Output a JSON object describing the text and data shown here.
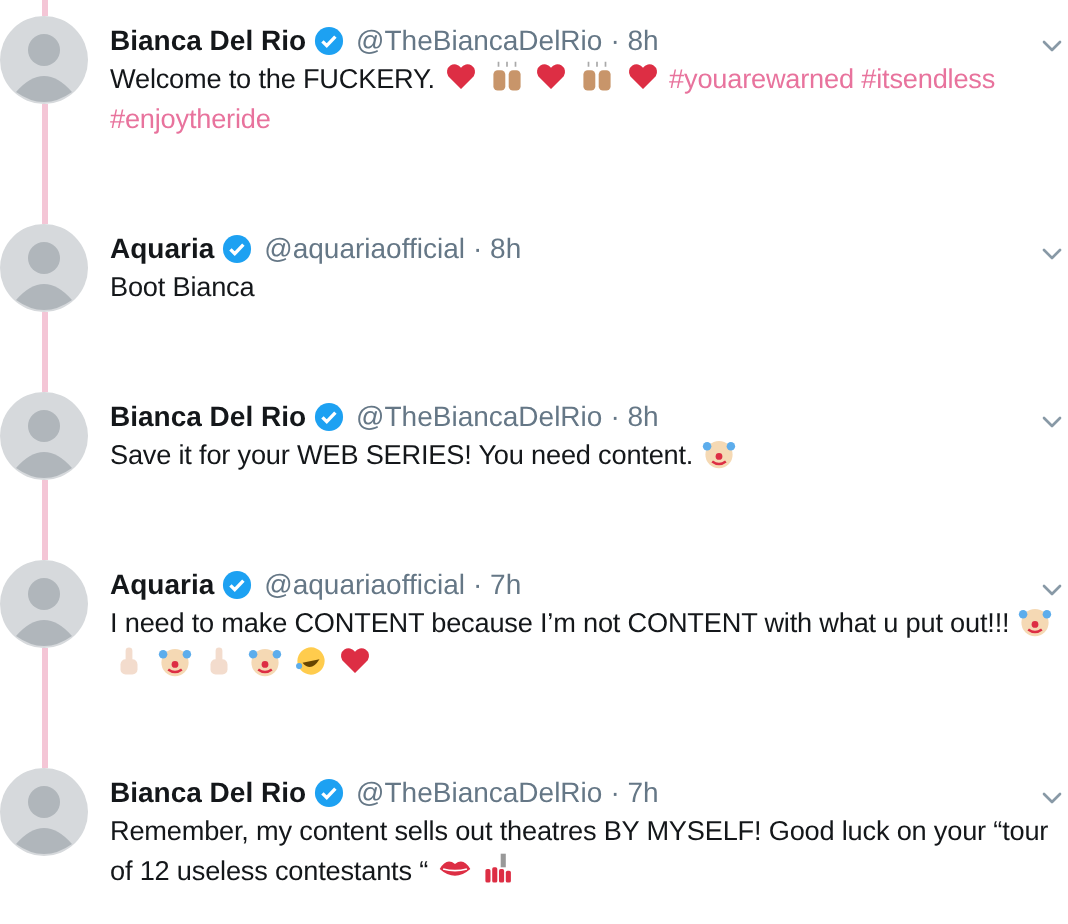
{
  "tweets": [
    {
      "name": "Bianca Del Rio",
      "verified": true,
      "handle": "@TheBiancaDelRio",
      "time": "· 8h",
      "connected": true,
      "body": [
        {
          "kind": "text",
          "text": "Welcome to the FUCKERY."
        },
        {
          "kind": "heart"
        },
        {
          "kind": "hands"
        },
        {
          "kind": "heart"
        },
        {
          "kind": "hands"
        },
        {
          "kind": "heart"
        },
        {
          "kind": "hashtag",
          "text": "#youarewarned"
        },
        {
          "kind": "hashtag",
          "text": "#itsendless"
        },
        {
          "kind": "hashtag",
          "text": "#enjoytheride"
        }
      ]
    },
    {
      "name": "Aquaria",
      "verified": true,
      "handle": "@aquariaofficial",
      "time": "· 8h",
      "connected": true,
      "body": [
        {
          "kind": "text",
          "text": "Boot Bianca"
        }
      ]
    },
    {
      "name": "Bianca Del Rio",
      "verified": true,
      "handle": "@TheBiancaDelRio",
      "time": "· 8h",
      "connected": true,
      "body": [
        {
          "kind": "text",
          "text": "Save it for your WEB SERIES! You need content."
        },
        {
          "kind": "clown"
        }
      ]
    },
    {
      "name": "Aquaria",
      "verified": true,
      "handle": "@aquariaofficial",
      "time": "· 7h",
      "connected": true,
      "body": [
        {
          "kind": "text",
          "text": "I need to make CONTENT because I’m not CONTENT with what u put out!!!"
        },
        {
          "kind": "clown"
        },
        {
          "kind": "finger"
        },
        {
          "kind": "clown"
        },
        {
          "kind": "finger"
        },
        {
          "kind": "clown"
        },
        {
          "kind": "laugh"
        },
        {
          "kind": "heart"
        }
      ]
    },
    {
      "name": "Bianca Del Rio",
      "verified": true,
      "handle": "@TheBiancaDelRio",
      "time": "· 7h",
      "connected": false,
      "body": [
        {
          "kind": "text",
          "text": "Remember, my content sells out theatres BY MYSELF! Good luck on your “tour"
        },
        {
          "kind": "text",
          "text": "of 12 useless contestants “"
        },
        {
          "kind": "lips"
        },
        {
          "kind": "polish"
        }
      ]
    }
  ]
}
